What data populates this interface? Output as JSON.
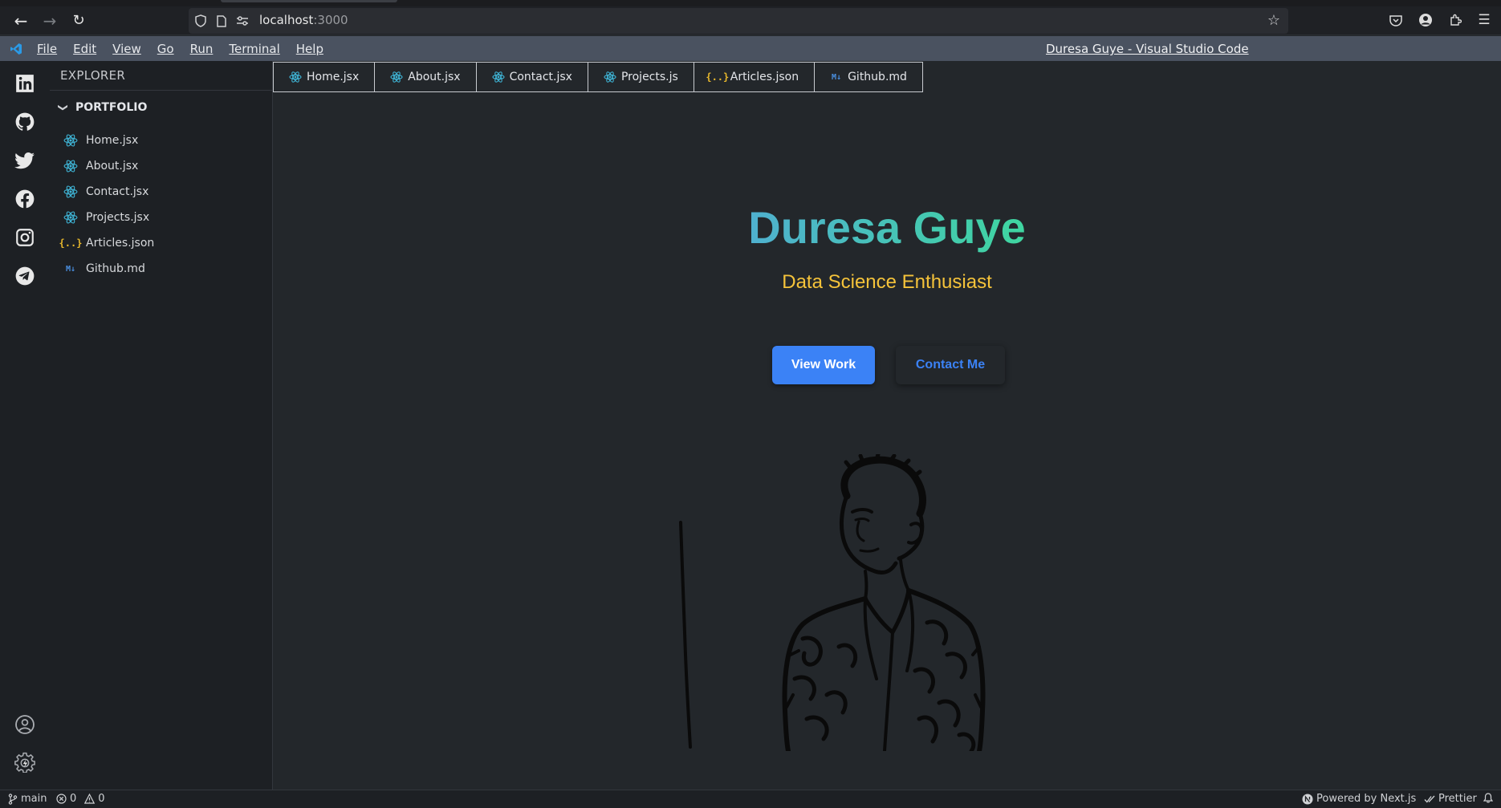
{
  "browser": {
    "url_host": "localhost",
    "url_port": ":3000"
  },
  "menubar": {
    "items": [
      "File",
      "Edit",
      "View",
      "Go",
      "Run",
      "Terminal",
      "Help"
    ],
    "window_title": "Duresa Guye - Visual Studio Code"
  },
  "activity_bar": {
    "icons": [
      "linkedin-icon",
      "github-icon",
      "twitter-icon",
      "facebook-icon",
      "instagram-icon",
      "telegram-icon",
      "account-icon",
      "settings-icon"
    ]
  },
  "explorer": {
    "title": "EXPLORER",
    "folder": "PORTFOLIO",
    "files": [
      {
        "label": "Home.jsx",
        "icon": "react-icon"
      },
      {
        "label": "About.jsx",
        "icon": "react-icon"
      },
      {
        "label": "Contact.jsx",
        "icon": "react-icon"
      },
      {
        "label": "Projects.jsx",
        "icon": "react-icon"
      },
      {
        "label": "Articles.json",
        "icon": "json-icon"
      },
      {
        "label": "Github.md",
        "icon": "markdown-icon"
      }
    ]
  },
  "tabs": [
    {
      "label": "Home.jsx",
      "icon": "react-icon"
    },
    {
      "label": "About.jsx",
      "icon": "react-icon"
    },
    {
      "label": "Contact.jsx",
      "icon": "react-icon"
    },
    {
      "label": "Projects.js",
      "icon": "react-icon"
    },
    {
      "label": "Articles.json",
      "icon": "json-icon"
    },
    {
      "label": "Github.md",
      "icon": "markdown-icon"
    }
  ],
  "hero": {
    "name": "Duresa Guye",
    "subtitle": "Data Science Enthusiast",
    "primary_button": "View Work",
    "secondary_button": "Contact Me"
  },
  "statusbar": {
    "branch": "main",
    "errors": "0",
    "warnings": "0",
    "powered_by": "Powered by Next.js",
    "formatter": "Prettier"
  },
  "colors": {
    "accent_blue": "#3b82f6",
    "subtitle_yellow": "#f5c33a",
    "gradient_start": "#4fb0cf",
    "gradient_end": "#3fd6a0",
    "react_cyan": "#3fb6d8",
    "json_yellow": "#e8b82c",
    "markdown_blue": "#4a8fe0"
  }
}
